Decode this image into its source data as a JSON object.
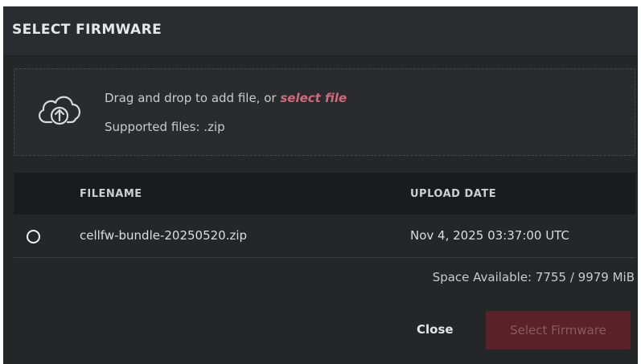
{
  "dialog": {
    "title": "SELECT FIRMWARE"
  },
  "dropzone": {
    "icon": "cloud-upload-icon",
    "text_prefix": "Drag and drop to add file, or ",
    "link_text": "select file",
    "supported": "Supported files: .zip"
  },
  "table": {
    "columns": [
      "FILENAME",
      "UPLOAD DATE"
    ],
    "rows": [
      {
        "filename": "cellfw-bundle-20250520.zip",
        "upload_date": "Nov 4, 2025 03:37:00 UTC",
        "selected": false
      }
    ]
  },
  "storage": {
    "space_available": "Space Available: 7755 / 9979 MiB"
  },
  "footer": {
    "close_label": "Close",
    "select_label": "Select Firmware"
  },
  "colors": {
    "background": "#252628",
    "accent": "#d06a7c",
    "primary_disabled": "#5a2228"
  }
}
